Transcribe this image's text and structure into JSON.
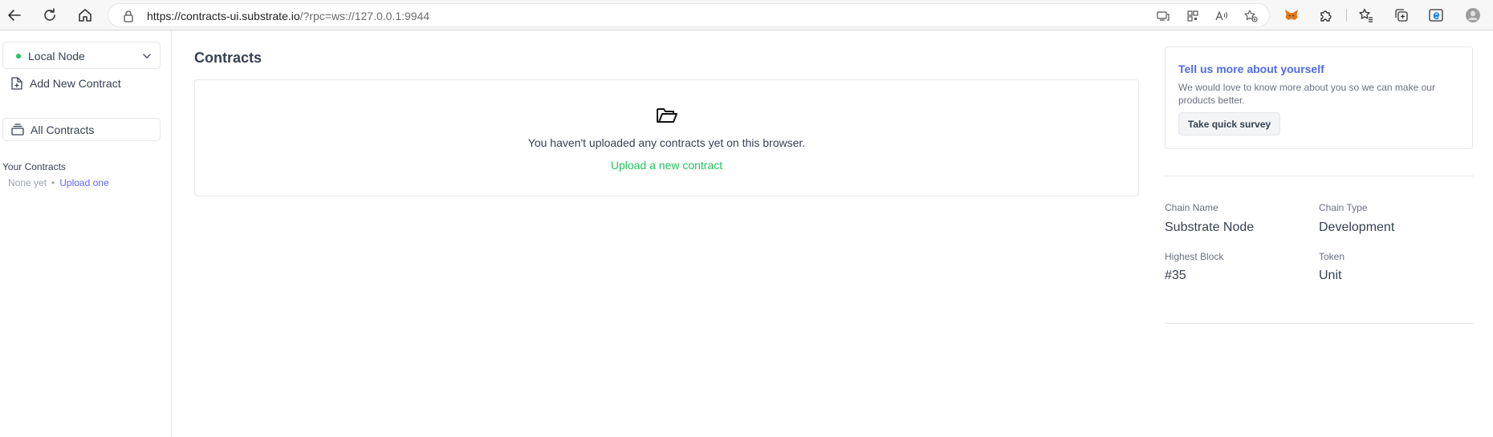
{
  "browser": {
    "url_host": "https://contracts-ui.substrate.io",
    "url_rest": "/?rpc=ws://127.0.0.1:9944"
  },
  "sidebar": {
    "node_label": "Local Node",
    "node_status_color": "#22c55e",
    "nav": [
      {
        "label": "Add New Contract",
        "icon": "file-plus-icon"
      },
      {
        "label": "All Contracts",
        "icon": "contracts-stack-icon"
      }
    ],
    "your_contracts_title": "Your Contracts",
    "none_yet": "None yet",
    "upload_one": "Upload one"
  },
  "main": {
    "title": "Contracts",
    "empty_message": "You haven't uploaded any contracts yet on this browser.",
    "upload_link": "Upload a new contract"
  },
  "survey": {
    "title": "Tell us more about yourself",
    "text": "We would love to know more about you so we can make our products better.",
    "button": "Take quick survey"
  },
  "chain": {
    "name_label": "Chain Name",
    "name_value": "Substrate Node",
    "type_label": "Chain Type",
    "type_value": "Development",
    "block_label": "Highest Block",
    "block_value": "#35",
    "token_label": "Token",
    "token_value": "Unit"
  },
  "colors": {
    "accent_green": "#22c55e",
    "link_indigo": "#6366f1",
    "survey_title_blue": "#4f6bed"
  }
}
